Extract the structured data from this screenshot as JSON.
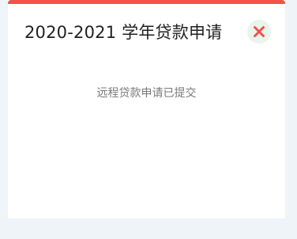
{
  "dialog": {
    "title": "2020-2021 学年贷款申请",
    "message": "远程贷款申请已提交",
    "close_icon": "close-icon"
  },
  "colors": {
    "accent_bar": "#f2524a",
    "close_icon": "#f2524a",
    "close_button_bg": "#e9f4ec",
    "page_bg": "#eff4f8",
    "dialog_bg": "#ffffff",
    "title_text": "#1f1f1f",
    "message_text": "#7a7a7a"
  }
}
